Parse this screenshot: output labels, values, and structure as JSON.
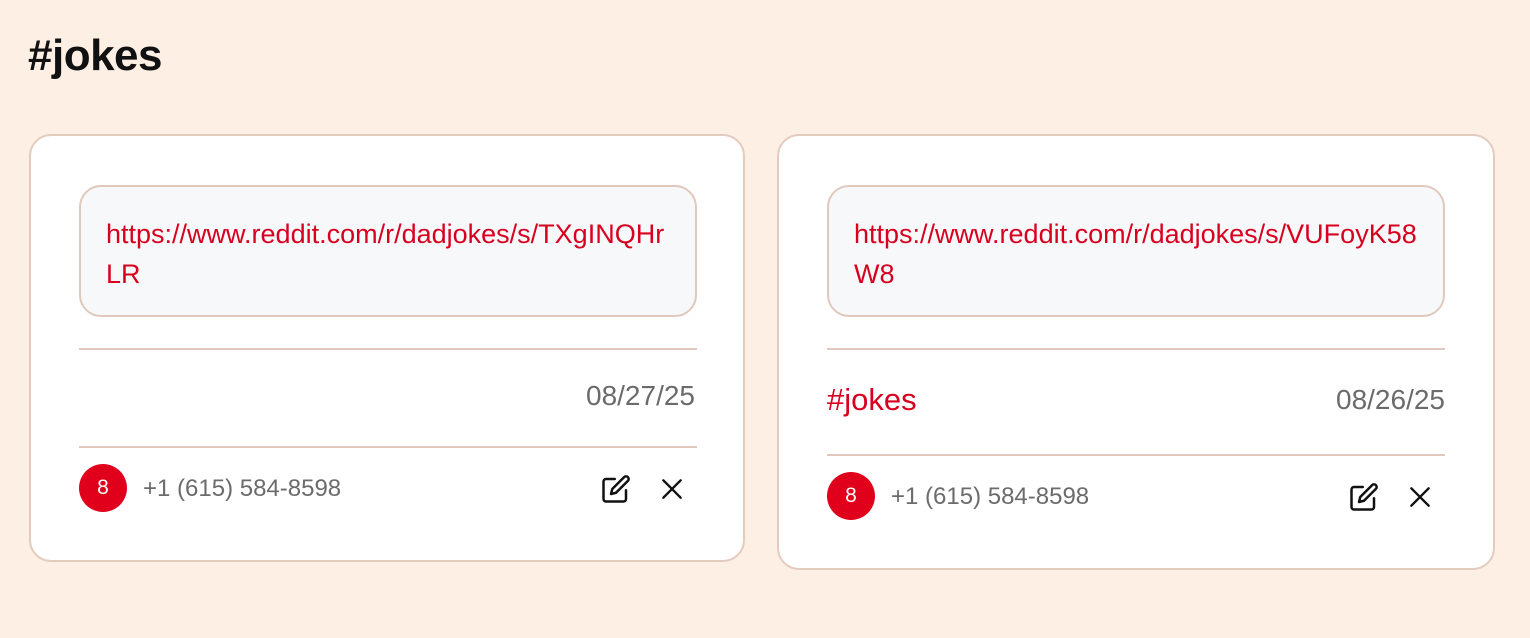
{
  "page": {
    "title": "#jokes"
  },
  "cards": [
    {
      "url": "https://www.reddit.com/r/dadjokes/s/TXgINQHrLR",
      "tag": "",
      "date": "08/27/25",
      "author": {
        "avatar_initial": "8",
        "phone": "+1 (615) 584-8598"
      },
      "actions": {
        "edit_icon": "edit-icon",
        "delete_icon": "close-icon"
      }
    },
    {
      "url": "https://www.reddit.com/r/dadjokes/s/VUFoyK58W8",
      "tag": "#jokes",
      "date": "08/26/25",
      "author": {
        "avatar_initial": "8",
        "phone": "+1 (615) 584-8598"
      },
      "actions": {
        "edit_icon": "edit-icon",
        "delete_icon": "close-icon"
      }
    }
  ],
  "colors": {
    "background": "#fdefe4",
    "accent": "#d8001f",
    "border": "#e0c9bc",
    "muted_text": "#6b6b6b"
  }
}
